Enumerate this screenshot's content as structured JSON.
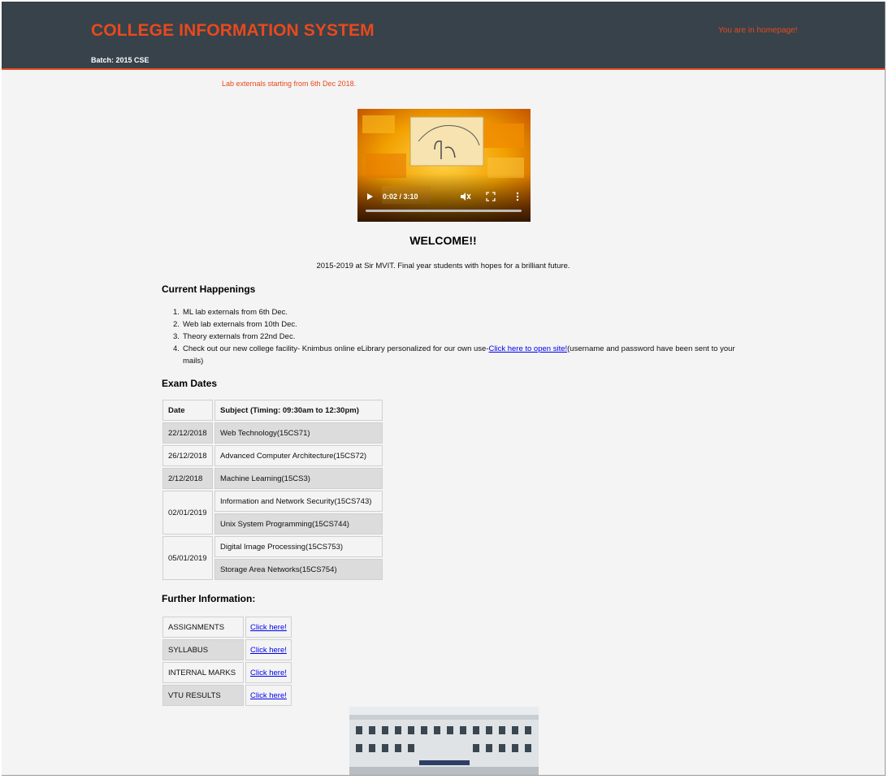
{
  "header": {
    "title": "COLLEGE INFORMATION SYSTEM",
    "homepage_msg": "You are in homepage!",
    "batch": "Batch: 2015 CSE"
  },
  "notice": "Lab externals starting from 6th Dec 2018.",
  "video": {
    "time": "0:02 / 3:10",
    "progress": 0.01,
    "controls": [
      "play-icon",
      "mute-icon",
      "fullscreen-icon",
      "more-options-icon"
    ]
  },
  "welcome": {
    "title": "WELCOME!!",
    "tagline": "2015-2019 at Sir MVIT. Final year students with hopes for a brilliant future."
  },
  "happenings": {
    "heading": "Current Happenings",
    "items": [
      {
        "num": "1.",
        "text": "ML lab externals from 6th Dec."
      },
      {
        "num": "2.",
        "text": "Web lab externals from 10th Dec."
      },
      {
        "num": "3.",
        "text": "Theory externals from 22nd Dec."
      },
      {
        "num": "4.",
        "text": "Check out our new college facility- Knimbus online eLibrary personalized for our own use-",
        "link": "Click here to open site!",
        "suffix": "(username and password have been sent to your mails)"
      }
    ]
  },
  "exams": {
    "heading": "Exam Dates",
    "headers": [
      "Date",
      "Subject (Timing: 09:30am to 12:30pm)"
    ],
    "rows": [
      {
        "date": "22/12/2018",
        "subject": "Web Technology(15CS71)"
      },
      {
        "date": "26/12/2018",
        "subject": "Advanced Computer Architecture(15CS72)"
      },
      {
        "date": "2/12/2018",
        "subject": "Machine Learning(15CS3)"
      },
      {
        "date": "02/01/2019",
        "subjects": [
          "Information and Network Security(15CS743)",
          "Unix System Programming(15CS744)"
        ]
      },
      {
        "date": "05/01/2019",
        "subjects": [
          "Digital Image Processing(15CS753)",
          "Storage Area Networks(15CS754)"
        ]
      }
    ]
  },
  "further": {
    "heading": "Further Information:",
    "rows": [
      {
        "label": "ASSIGNMENTS",
        "link": "Click here!"
      },
      {
        "label": "SYLLABUS",
        "link": "Click here!"
      },
      {
        "label": "INTERNAL MARKS",
        "link": "Click here!"
      },
      {
        "label": "VTU RESULTS",
        "link": "Click here!"
      }
    ]
  },
  "colors": {
    "header_bg": "#37424a",
    "accent": "#e8491d",
    "page_bg": "#f4f4f4",
    "link": "#0000ee"
  }
}
